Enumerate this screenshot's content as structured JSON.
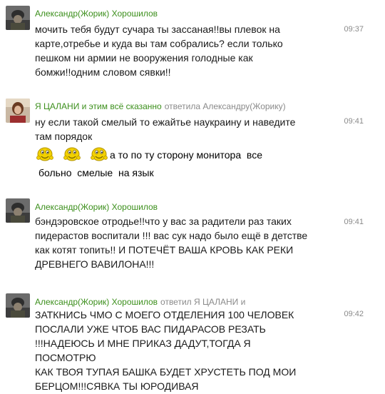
{
  "comments": [
    {
      "author": "Александр(Жорик) Хорошилов",
      "reply_to": "",
      "time": "09:37",
      "text": " мочить тебя будут сучара ты зассаная!!вы плевок на\nкарте,отребье и куда вы там собрались? если только\nпешком ни армии не вооружения голодные как\nбомжи!!одним словом сявки!!",
      "avatar": "soldier-avatar"
    },
    {
      "author": "Я ЦАЛАНИ и этим всё сказанно",
      "reply_to": "ответила Александру(Жорику)",
      "time": "09:41",
      "text": "ну если такой смелый то ежайтье наукраину и наведите\nтам порядок",
      "smiley_text": "а то по ту сторону монитора  все",
      "extra_line": "больно  смелые  на язык",
      "avatar": "woman-avatar"
    },
    {
      "author": "Александр(Жорик) Хорошилов",
      "reply_to": "",
      "time": "09:41",
      "text": "бэндэровское отродье!!что у вас за радители раз таких\nпидерастов  воспитали !!! вас сук надо было ещё в детстве\nкак котят топить!! И ПОТЕЧЁТ ВАША КРОВЬ КАК РЕКИ\nДРЕВНЕГО ВАВИЛОНА!!!",
      "avatar": "soldier-avatar"
    },
    {
      "author": "Александр(Жорик) Хорошилов",
      "reply_to": "ответил Я ЦАЛАНИ и",
      "time": "09:42",
      "text": "ЗАТКНИСЬ ЧМО С МОЕГО ОТДЕЛЕНИЯ 100 ЧЕЛОВЕК\nПОСЛАЛИ УЖЕ ЧТОБ ВАС ПИДАРАСОВ РЕЗАТЬ\n!!!НАДЕЮСЬ И МНЕ ПРИКАЗ ДАДУТ,ТОГДА Я ПОСМОТРЮ\nКАК ТВОЯ ТУПАЯ БАШКА БУДЕТ ХРУСТЕТЬ ПОД МОИ\nБЕРЦОМ!!!СЯВКА ТЫ ЮРОДИВАЯ",
      "avatar": "soldier-avatar"
    }
  ],
  "colors": {
    "author": "#3c8f1c",
    "meta": "#8a8a8a"
  },
  "icons": [
    "soldier-avatar-icon",
    "woman-avatar-icon",
    "laughing-smiley-icon"
  ]
}
